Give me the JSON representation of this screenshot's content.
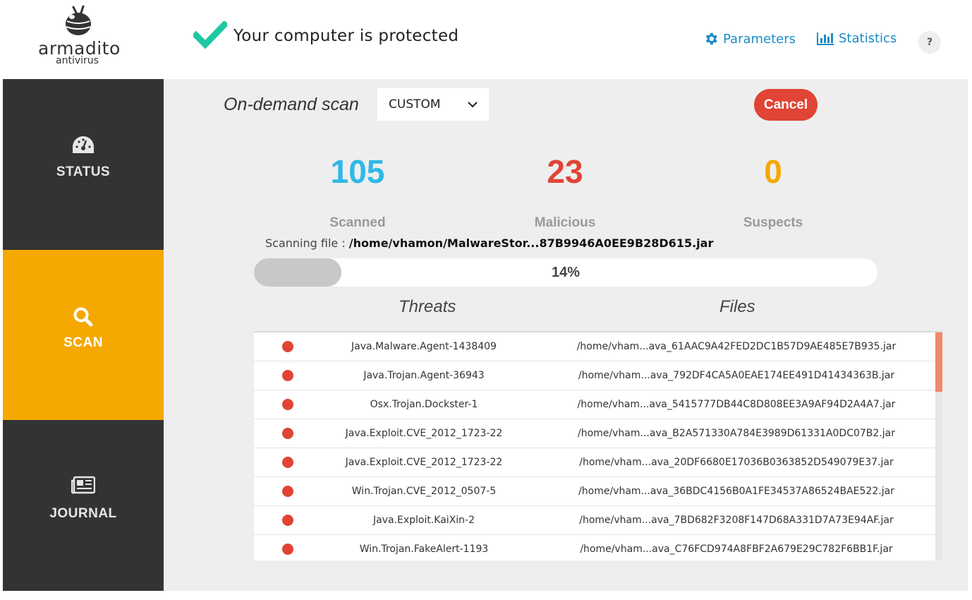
{
  "app": {
    "logo_word": "armadito",
    "logo_sub": "antivirus",
    "status_text": "Your computer is protected",
    "nav": {
      "parameters": "Parameters",
      "statistics": "Statistics",
      "help": "?"
    }
  },
  "sidebar": {
    "items": [
      {
        "label": "STATUS",
        "icon": "dashboard-icon"
      },
      {
        "label": "SCAN",
        "icon": "search-icon",
        "active": true
      },
      {
        "label": "JOURNAL",
        "icon": "newspaper-icon"
      }
    ]
  },
  "scan": {
    "title": "On-demand scan",
    "mode": "CUSTOM",
    "cancel_label": "Cancel",
    "stats": [
      {
        "value": "105",
        "label": "Scanned",
        "color": "#2fb8e8"
      },
      {
        "value": "23",
        "label": "Malicious",
        "color": "#e04434"
      },
      {
        "value": "0",
        "label": "Suspects",
        "color": "#f5a800"
      }
    ],
    "scanning_label": "Scanning file : ",
    "scanning_path": "/home/vhamon/MalwareStor...87B9946A0EE9B28D615.jar",
    "progress_percent": 14,
    "progress_text": "14%",
    "columns": {
      "threats": "Threats",
      "files": "Files"
    },
    "rows": [
      {
        "threat": "Java.Malware.Agent-1438409",
        "file": "/home/vham...ava_61AAC9A42FED2DC1B57D9AE485E7B935.jar"
      },
      {
        "threat": "Java.Trojan.Agent-36943",
        "file": "/home/vham...ava_792DF4CA5A0EAE174EE491D41434363B.jar"
      },
      {
        "threat": "Osx.Trojan.Dockster-1",
        "file": "/home/vham...ava_5415777DB44C8D808EE3A9AF94D2A4A7.jar"
      },
      {
        "threat": "Java.Exploit.CVE_2012_1723-22",
        "file": "/home/vham...ava_B2A571330A784E3989D61331A0DC07B2.jar"
      },
      {
        "threat": "Java.Exploit.CVE_2012_1723-22",
        "file": "/home/vham...ava_20DF6680E17036B0363852D549079E37.jar"
      },
      {
        "threat": "Win.Trojan.CVE_2012_0507-5",
        "file": "/home/vham...ava_36BDC4156B0A1FE34537A86524BAE522.jar"
      },
      {
        "threat": "Java.Exploit.KaiXin-2",
        "file": "/home/vham...ava_7BD682F3208F147D68A331D7A73E94AF.jar"
      },
      {
        "threat": "Win.Trojan.FakeAlert-1193",
        "file": "/home/vham...ava_C76FCD974A8FBF2A679E29C782F6BB1F.jar"
      }
    ]
  },
  "colors": {
    "accent": "#f5a800",
    "sidebar_bg": "#333333",
    "link": "#1a8cc9",
    "danger": "#e04434",
    "check": "#1ec8a0"
  }
}
